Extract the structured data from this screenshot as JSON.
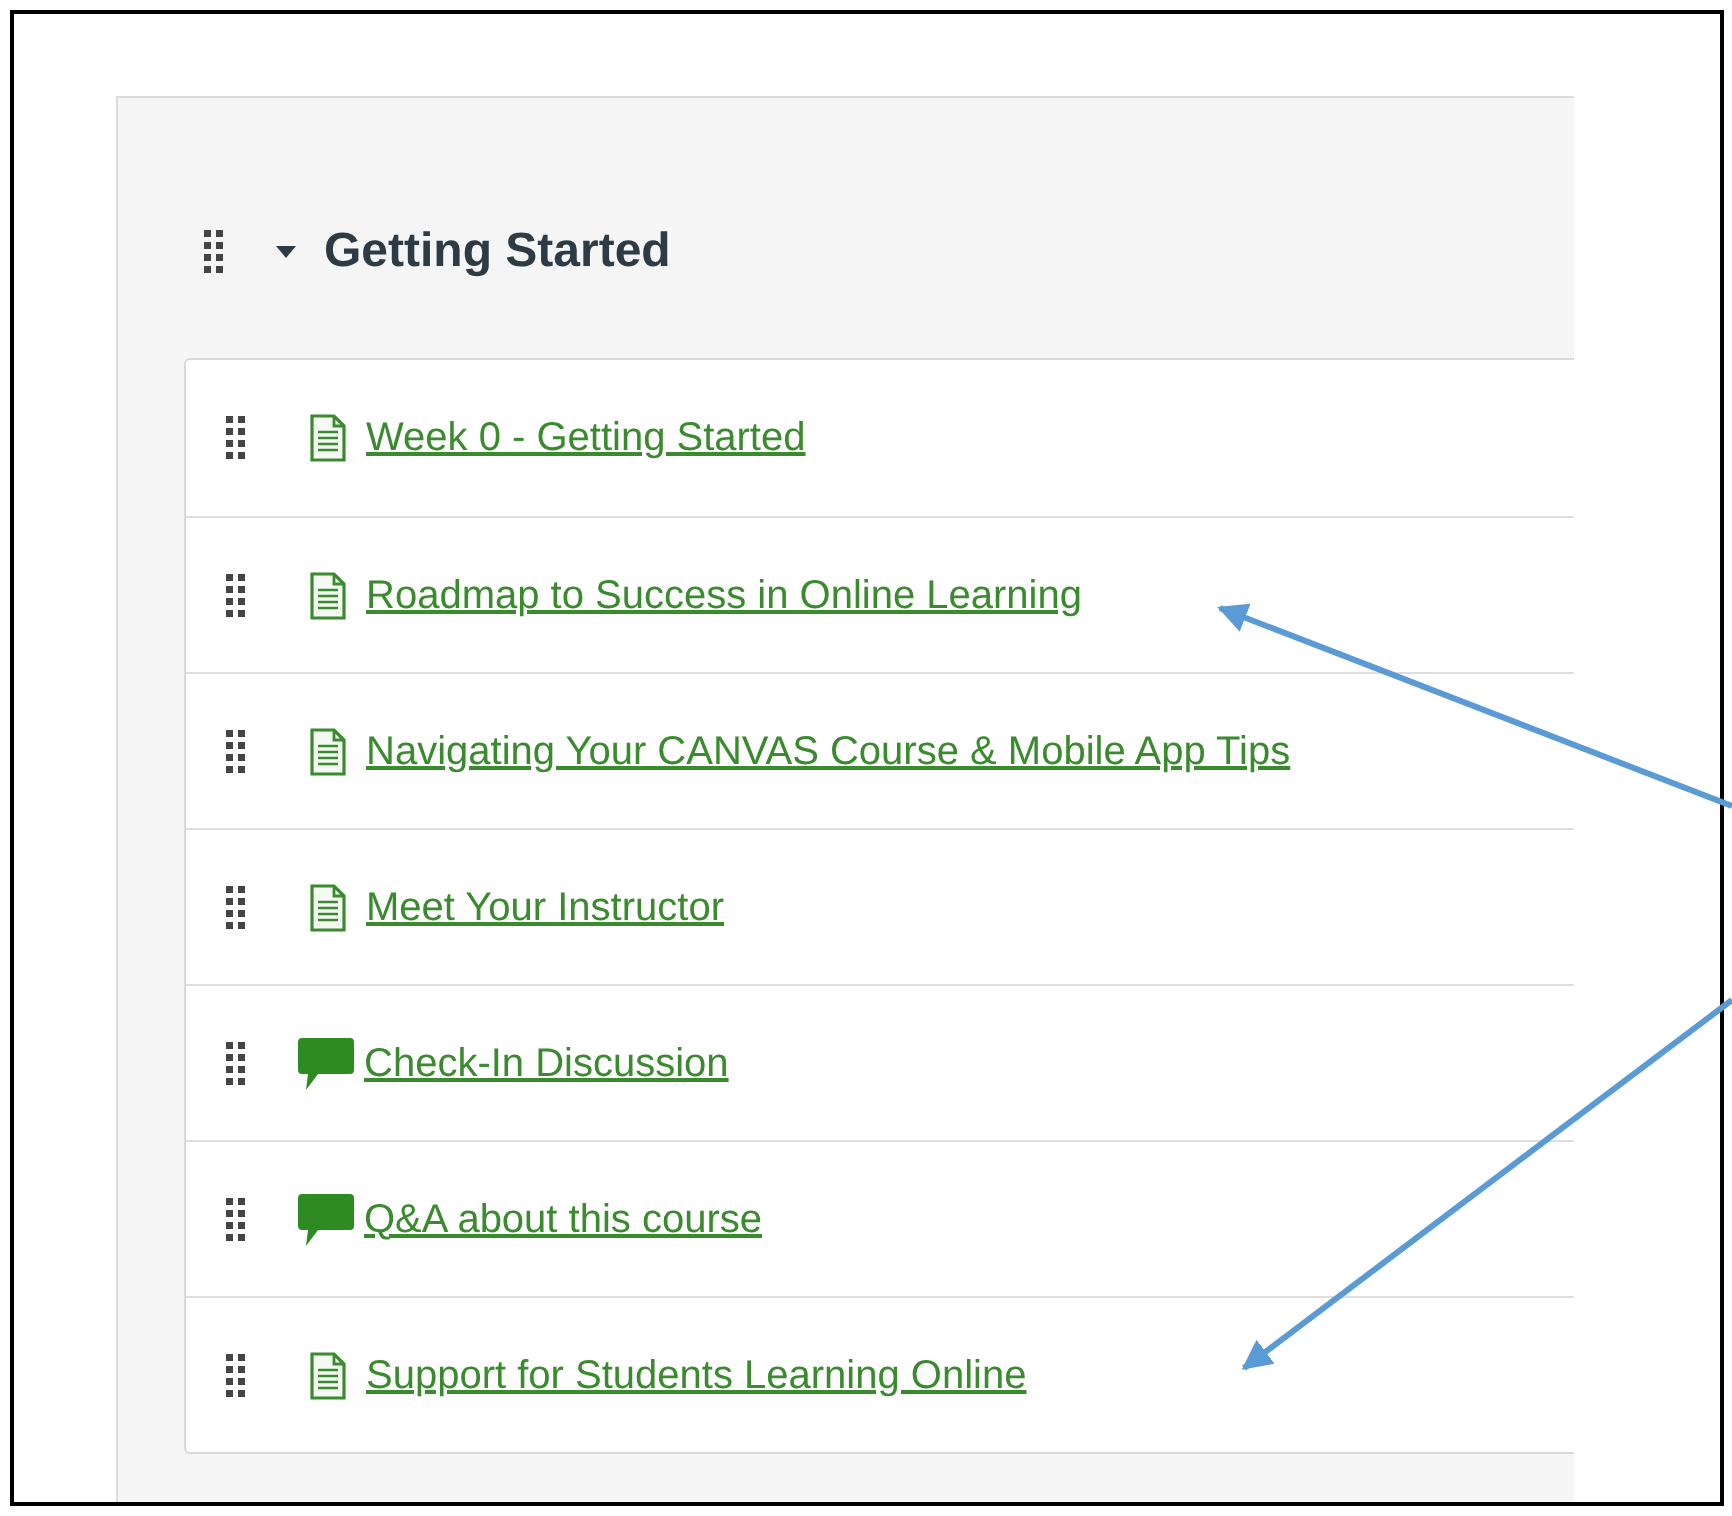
{
  "module": {
    "title": "Getting Started",
    "expanded": true,
    "items": [
      {
        "kind": "page",
        "title": "Week 0 - Getting Started"
      },
      {
        "kind": "page",
        "title": "Roadmap to Success in Online Learning"
      },
      {
        "kind": "page",
        "title": "Navigating Your CANVAS Course & Mobile App Tips"
      },
      {
        "kind": "page",
        "title": "Meet Your Instructor"
      },
      {
        "kind": "discussion",
        "title": "Check-In Discussion"
      },
      {
        "kind": "discussion",
        "title": "Q&A about this course"
      },
      {
        "kind": "page",
        "title": "Support for Students Learning Online"
      }
    ]
  }
}
